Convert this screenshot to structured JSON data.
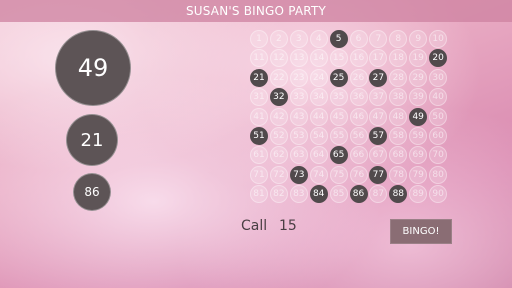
{
  "header": {
    "title": "SUSAN'S BINGO PARTY"
  },
  "recent_calls": [
    {
      "number": "49"
    },
    {
      "number": "21"
    },
    {
      "number": "86"
    }
  ],
  "board": {
    "numbers": [
      1,
      2,
      3,
      4,
      5,
      6,
      7,
      8,
      9,
      10,
      11,
      12,
      13,
      14,
      15,
      16,
      17,
      18,
      19,
      20,
      21,
      22,
      23,
      24,
      25,
      26,
      27,
      28,
      29,
      30,
      31,
      32,
      33,
      34,
      35,
      36,
      37,
      38,
      39,
      40,
      41,
      42,
      43,
      44,
      45,
      46,
      47,
      48,
      49,
      50,
      51,
      52,
      53,
      54,
      55,
      56,
      57,
      58,
      59,
      60,
      61,
      62,
      63,
      64,
      65,
      66,
      67,
      68,
      69,
      70,
      71,
      72,
      73,
      74,
      75,
      76,
      77,
      78,
      79,
      80,
      81,
      82,
      83,
      84,
      85,
      86,
      87,
      88,
      89,
      90
    ],
    "called": [
      5,
      20,
      21,
      25,
      27,
      32,
      49,
      51,
      57,
      65,
      73,
      77,
      84,
      86,
      88
    ]
  },
  "status": {
    "call_label": "Call",
    "call_count": "15"
  },
  "actions": {
    "bingo_label": "BINGO!"
  },
  "colors": {
    "called_ball": "#514a4c",
    "title_bar": "#cd82a0",
    "button": "#8a6d74"
  }
}
